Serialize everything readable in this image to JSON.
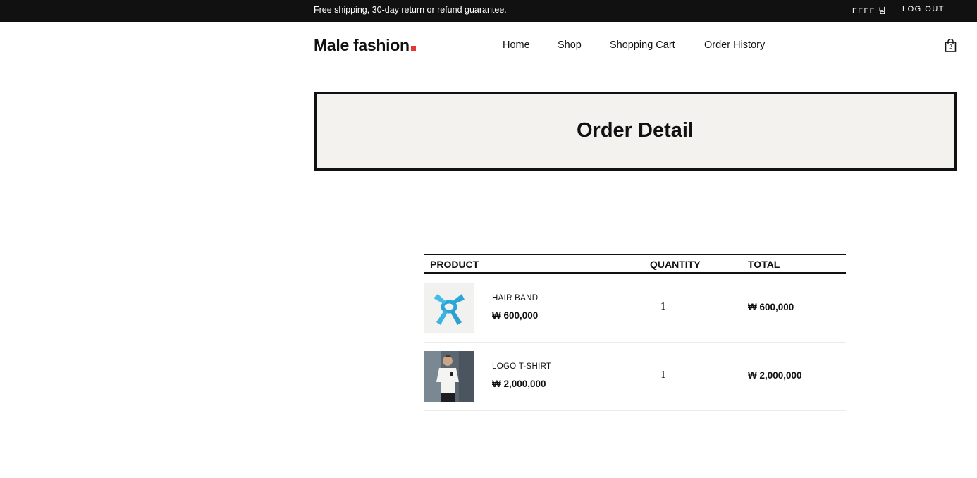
{
  "topbar": {
    "promo": "Free shipping, 30-day return or refund guarantee.",
    "user": "FFFF 님",
    "logout": "LOG OUT"
  },
  "header": {
    "logo": "Male fashion",
    "nav": [
      "Home",
      "Shop",
      "Shopping Cart",
      "Order History"
    ],
    "cart_count": "2"
  },
  "page": {
    "title": "Order Detail"
  },
  "order_table": {
    "headers": [
      "PRODUCT",
      "QUANTITY",
      "TOTAL"
    ],
    "rows": [
      {
        "name": "HAIR BAND",
        "price": "₩ 600,000",
        "quantity": "1",
        "total": "₩ 600,000",
        "image": "hair-band-image"
      },
      {
        "name": "LOGO T-SHIRT",
        "price": "₩ 2,000,000",
        "quantity": "1",
        "total": "₩ 2,000,000",
        "image": "logo-tshirt-image"
      }
    ]
  },
  "colors": {
    "topbar_bg": "#111111",
    "accent": "#e53637",
    "title_bg": "#f3f2ee"
  }
}
